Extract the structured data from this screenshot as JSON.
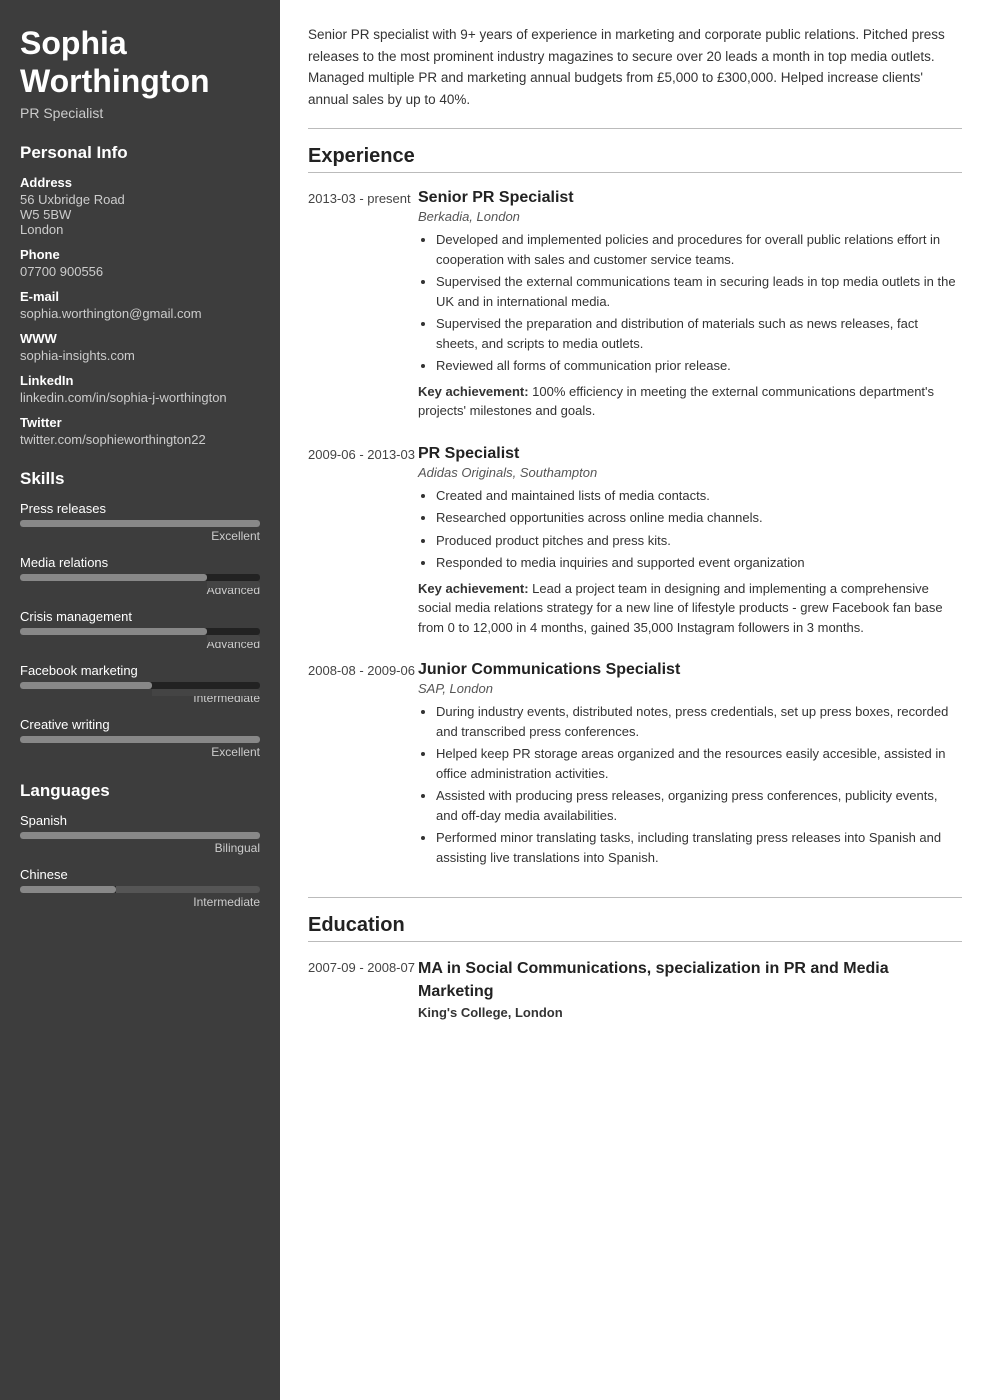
{
  "sidebar": {
    "name": "Sophia Worthington",
    "title": "PR Specialist",
    "personal_info_label": "Personal Info",
    "address_label": "Address",
    "address": "56 Uxbridge Road\nW5 5BW\nLondon",
    "phone_label": "Phone",
    "phone": "07700 900556",
    "email_label": "E-mail",
    "email": "sophia.worthington@gmail.com",
    "www_label": "WWW",
    "www": "sophia-insights.com",
    "linkedin_label": "LinkedIn",
    "linkedin": "linkedin.com/in/sophia-j-worthington",
    "twitter_label": "Twitter",
    "twitter": "twitter.com/sophieworthington22",
    "skills_label": "Skills",
    "skills": [
      {
        "name": "Press releases",
        "fill_pct": 100,
        "level": "Excellent"
      },
      {
        "name": "Media relations",
        "fill_pct": 78,
        "level": "Advanced"
      },
      {
        "name": "Crisis management",
        "fill_pct": 78,
        "level": "Advanced"
      },
      {
        "name": "Facebook marketing",
        "fill_pct": 55,
        "level": "Intermediate"
      },
      {
        "name": "Creative writing",
        "fill_pct": 100,
        "level": "Excellent"
      }
    ],
    "languages_label": "Languages",
    "languages": [
      {
        "name": "Spanish",
        "fill_pct": 100,
        "level": "Bilingual"
      },
      {
        "name": "Chinese",
        "fill_pct": 40,
        "level": "Intermediate"
      }
    ]
  },
  "main": {
    "summary": "Senior PR specialist with 9+ years of experience in marketing and corporate public relations. Pitched press releases to the most prominent industry magazines to secure over 20 leads a month in top media outlets. Managed multiple PR and marketing annual budgets from £5,000 to £300,000. Helped increase clients' annual sales by up to 40%.",
    "experience_label": "Experience",
    "experiences": [
      {
        "date": "2013-03 - present",
        "title": "Senior PR Specialist",
        "company": "Berkadia, London",
        "bullets": [
          "Developed and implemented policies and procedures for overall public relations effort in cooperation with sales and customer service teams.",
          "Supervised the external communications team in securing leads in top media outlets in the UK and in international media.",
          "Supervised the preparation and distribution of materials such as news releases, fact sheets, and scripts to media outlets.",
          "Reviewed all forms of communication prior release."
        ],
        "key_achievement": "100% efficiency in meeting the external communications department's projects' milestones and goals."
      },
      {
        "date": "2009-06 - 2013-03",
        "title": "PR Specialist",
        "company": "Adidas Originals, Southampton",
        "bullets": [
          "Created and maintained lists of media contacts.",
          "Researched opportunities across online media channels.",
          "Produced product pitches and press kits.",
          "Responded to media inquiries and supported event organization"
        ],
        "key_achievement": "Lead a project team in designing and implementing a comprehensive social media relations strategy for a new line of lifestyle products - grew Facebook fan base from 0 to 12,000 in 4 months, gained 35,000 Instagram followers in 3 months."
      },
      {
        "date": "2008-08 - 2009-06",
        "title": "Junior Communications Specialist",
        "company": "SAP, London",
        "bullets": [
          "During industry events, distributed notes, press credentials, set up press boxes, recorded and transcribed press conferences.",
          "Helped keep PR storage areas organized and the resources easily accesible, assisted in office administration activities.",
          "Assisted with producing press releases, organizing press conferences, publicity events, and off-day media availabilities.",
          "Performed minor translating tasks, including translating press releases into Spanish and assisting live translations into Spanish."
        ],
        "key_achievement": ""
      }
    ],
    "education_label": "Education",
    "educations": [
      {
        "date": "2007-09 - 2008-07",
        "degree": "MA in Social Communications, specialization in PR and Media Marketing",
        "school": "King's College, London"
      }
    ]
  }
}
